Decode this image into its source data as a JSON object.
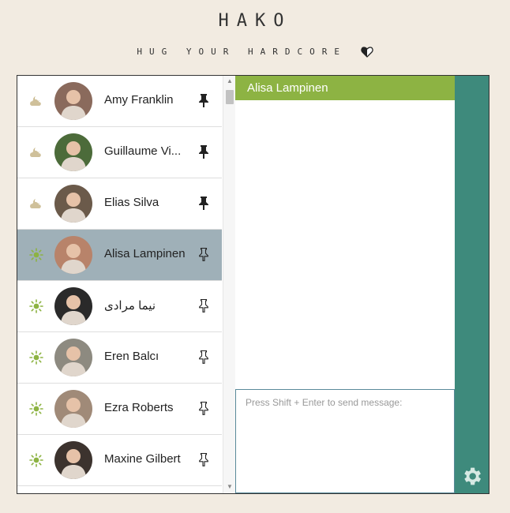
{
  "brand": {
    "title": "HAKO",
    "tagline": "HUG YOUR HARDCORE"
  },
  "contacts": [
    {
      "name": "Amy Franklin",
      "status": "cloudy-night-icon",
      "pinned": true,
      "avatar_color": "#8a6a5c"
    },
    {
      "name": "Guillaume Vi...",
      "status": "cloudy-night-icon",
      "pinned": true,
      "avatar_color": "#4c6b3a"
    },
    {
      "name": "Elias Silva",
      "status": "cloudy-night-icon",
      "pinned": true,
      "avatar_color": "#6b5a4a"
    },
    {
      "name": "Alisa Lampinen",
      "status": "sun-icon",
      "pinned": false,
      "active": true,
      "avatar_color": "#b8836a"
    },
    {
      "name": "نیما مرادی",
      "status": "sun-icon",
      "pinned": false,
      "avatar_color": "#2a2a2a"
    },
    {
      "name": "Eren Balcı",
      "status": "sun-icon",
      "pinned": false,
      "avatar_color": "#8d8a80"
    },
    {
      "name": "Ezra Roberts",
      "status": "sun-icon",
      "pinned": false,
      "avatar_color": "#a08a78"
    },
    {
      "name": "Maxine Gilbert",
      "status": "sun-icon",
      "pinned": false,
      "avatar_color": "#3c332e"
    }
  ],
  "chat": {
    "header": "Alisa Lampinen",
    "composer_placeholder": "Press Shift + Enter to send message:"
  },
  "colors": {
    "accent": "#8db343",
    "rail": "#3e8a7c",
    "active_row": "#9fb0b8",
    "background": "#f2ebe1"
  }
}
